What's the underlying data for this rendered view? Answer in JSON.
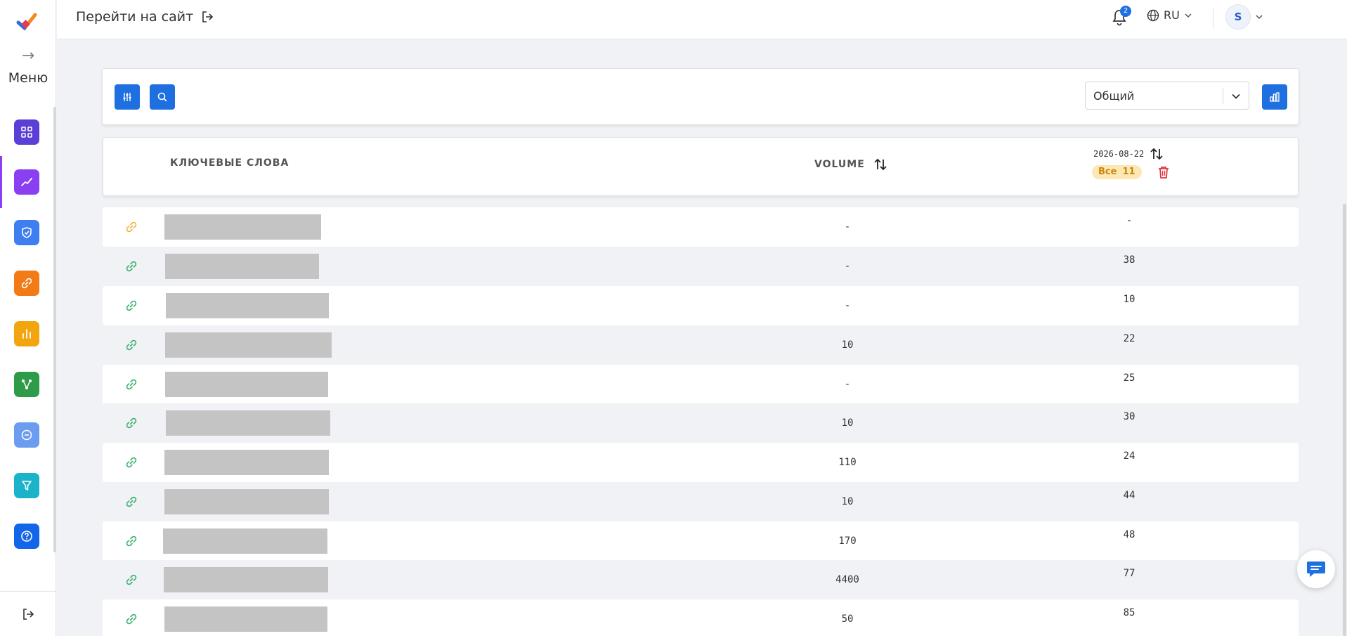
{
  "sidebar": {
    "menu_label": "Меню",
    "menu_arrow": "→",
    "items": [
      {
        "name": "dashboard",
        "icon": "grid-icon",
        "color": "#5b3fd6"
      },
      {
        "name": "positions",
        "icon": "trend-icon",
        "color": "#8a3ff2"
      },
      {
        "name": "audit",
        "icon": "shield-check-icon",
        "color": "#3f7ef0"
      },
      {
        "name": "links",
        "icon": "link-icon",
        "color": "#f27b16"
      },
      {
        "name": "analytics",
        "icon": "bar-chart-icon",
        "color": "#f2a50c"
      },
      {
        "name": "clusters",
        "icon": "network-icon",
        "color": "#2e9b48"
      },
      {
        "name": "minus",
        "icon": "minus-circle-icon",
        "color": "#6c9cf0"
      },
      {
        "name": "filter",
        "icon": "filter-icon",
        "color": "#1ab3c9"
      },
      {
        "name": "help",
        "icon": "question-icon",
        "color": "#1466e8"
      }
    ]
  },
  "header": {
    "goto_site": "Перейти на сайт",
    "notifications_count": "2",
    "language": "RU",
    "avatar_letter": "S"
  },
  "toolbar": {
    "select_value": "Общий"
  },
  "table": {
    "col_keywords": "КЛЮЧЕВЫЕ СЛОВА",
    "col_volume": "VOLUME",
    "col_date": "2026-08-22",
    "badge_label": "Все",
    "badge_count": "11",
    "rows": [
      {
        "volume": "-",
        "position": "-",
        "link_color": "#f0b43c"
      },
      {
        "volume": "-",
        "position": "38",
        "link_color": "#3cb371"
      },
      {
        "volume": "-",
        "position": "10",
        "link_color": "#3cb371"
      },
      {
        "volume": "10",
        "position": "22",
        "link_color": "#3cb371"
      },
      {
        "volume": "-",
        "position": "25",
        "link_color": "#3cb371"
      },
      {
        "volume": "10",
        "position": "30",
        "link_color": "#3cb371"
      },
      {
        "volume": "110",
        "position": "24",
        "link_color": "#3cb371"
      },
      {
        "volume": "10",
        "position": "44",
        "link_color": "#3cb371"
      },
      {
        "volume": "170",
        "position": "48",
        "link_color": "#3cb371"
      },
      {
        "volume": "4400",
        "position": "77",
        "link_color": "#3cb371"
      },
      {
        "volume": "50",
        "position": "85",
        "link_color": "#3cb371"
      }
    ]
  },
  "colors": {
    "primary": "#1e6fe0",
    "badge_bg": "#fde8b5",
    "trash": "#e0343d"
  }
}
